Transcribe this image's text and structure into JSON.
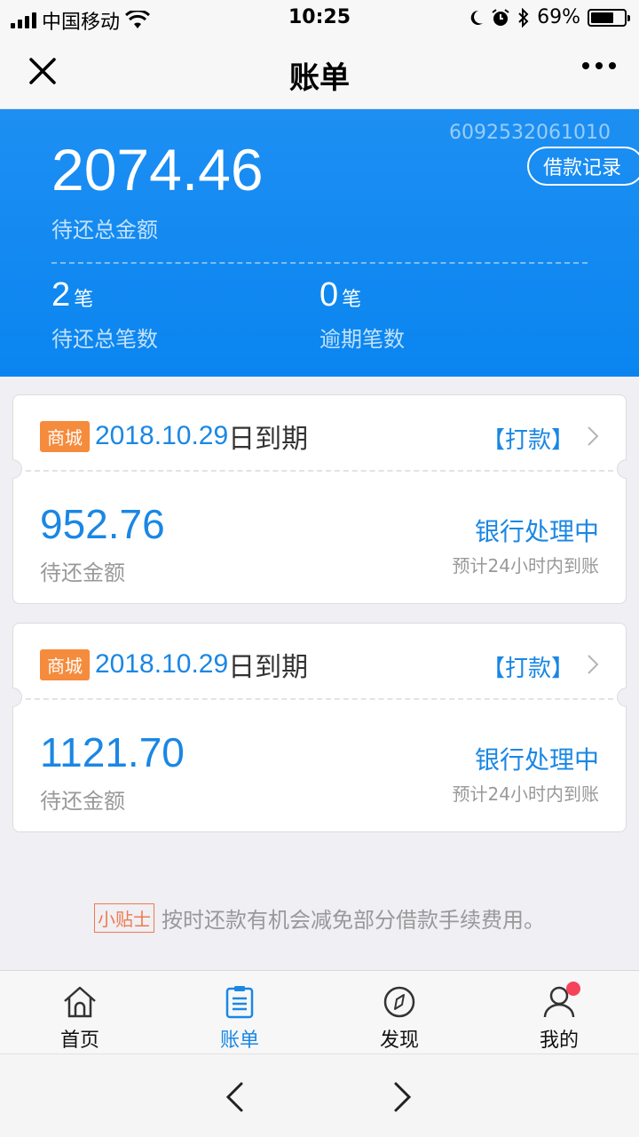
{
  "status_bar": {
    "carrier": "中国移动",
    "time": "10:25",
    "battery": "69%",
    "battery_level": 0.69
  },
  "nav": {
    "title": "账单",
    "close_icon": "close-icon",
    "more_icon": "more-icon"
  },
  "summary": {
    "account_no": "6092532061010",
    "loan_record_label": "借款记录",
    "total_amount": "2074.46",
    "total_label": "待还总金额",
    "pending_count": "2",
    "pending_unit": "笔",
    "pending_label": "待还总笔数",
    "overdue_count": "0",
    "overdue_unit": "笔",
    "overdue_label": "逾期笔数"
  },
  "bills": [
    {
      "tag": "商城",
      "due_date": "2018.10.29",
      "due_suffix": "日到期",
      "pay_label": "【打款】",
      "amount": "952.76",
      "amount_label": "待还金额",
      "status": "银行处理中",
      "note": "预计24小时内到账"
    },
    {
      "tag": "商城",
      "due_date": "2018.10.29",
      "due_suffix": "日到期",
      "pay_label": "【打款】",
      "amount": "1121.70",
      "amount_label": "待还金额",
      "status": "银行处理中",
      "note": "预计24小时内到账"
    }
  ],
  "tip": {
    "tag": "小贴士",
    "text": "按时还款有机会减免部分借款手续费用。"
  },
  "tabs": [
    {
      "label": "首页",
      "icon": "home-icon"
    },
    {
      "label": "账单",
      "icon": "bill-icon"
    },
    {
      "label": "发现",
      "icon": "compass-icon"
    },
    {
      "label": "我的",
      "icon": "user-icon"
    }
  ],
  "colors": {
    "accent": "#1a87e4",
    "header_bg": "#0a85f0",
    "tag_orange": "#f58b3c",
    "badge_red": "#f5435c"
  }
}
